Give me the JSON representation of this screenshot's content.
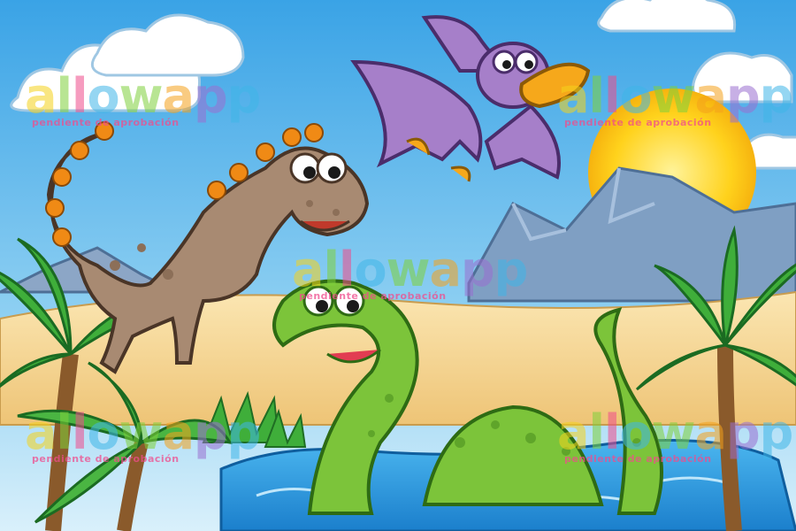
{
  "image": {
    "kind": "cartoon illustration",
    "palette": {
      "sky": "#5ab8ec",
      "sky_light": "#bfe6f7",
      "sun": "#ffd21c",
      "mountain": "#7f9fc3",
      "sand": "#f3d28a",
      "water": "#2e9ee0",
      "palm": "#3fae3a",
      "trex": "#a88a72",
      "trex_spikes": "#f08a15",
      "pterodactyl": "#a67fc9",
      "beak": "#f6a81b",
      "plesiosaur": "#7cc43a"
    }
  },
  "watermark": {
    "brand": "allowapp",
    "subtitle": "pendiente de aprobación",
    "letter_colors": [
      "#f5d31c",
      "#7fd13b",
      "#f04c8c",
      "#3fb6e8",
      "#7fd13b",
      "#f5a21c",
      "#9a6fd1",
      "#3fb6e8"
    ]
  }
}
